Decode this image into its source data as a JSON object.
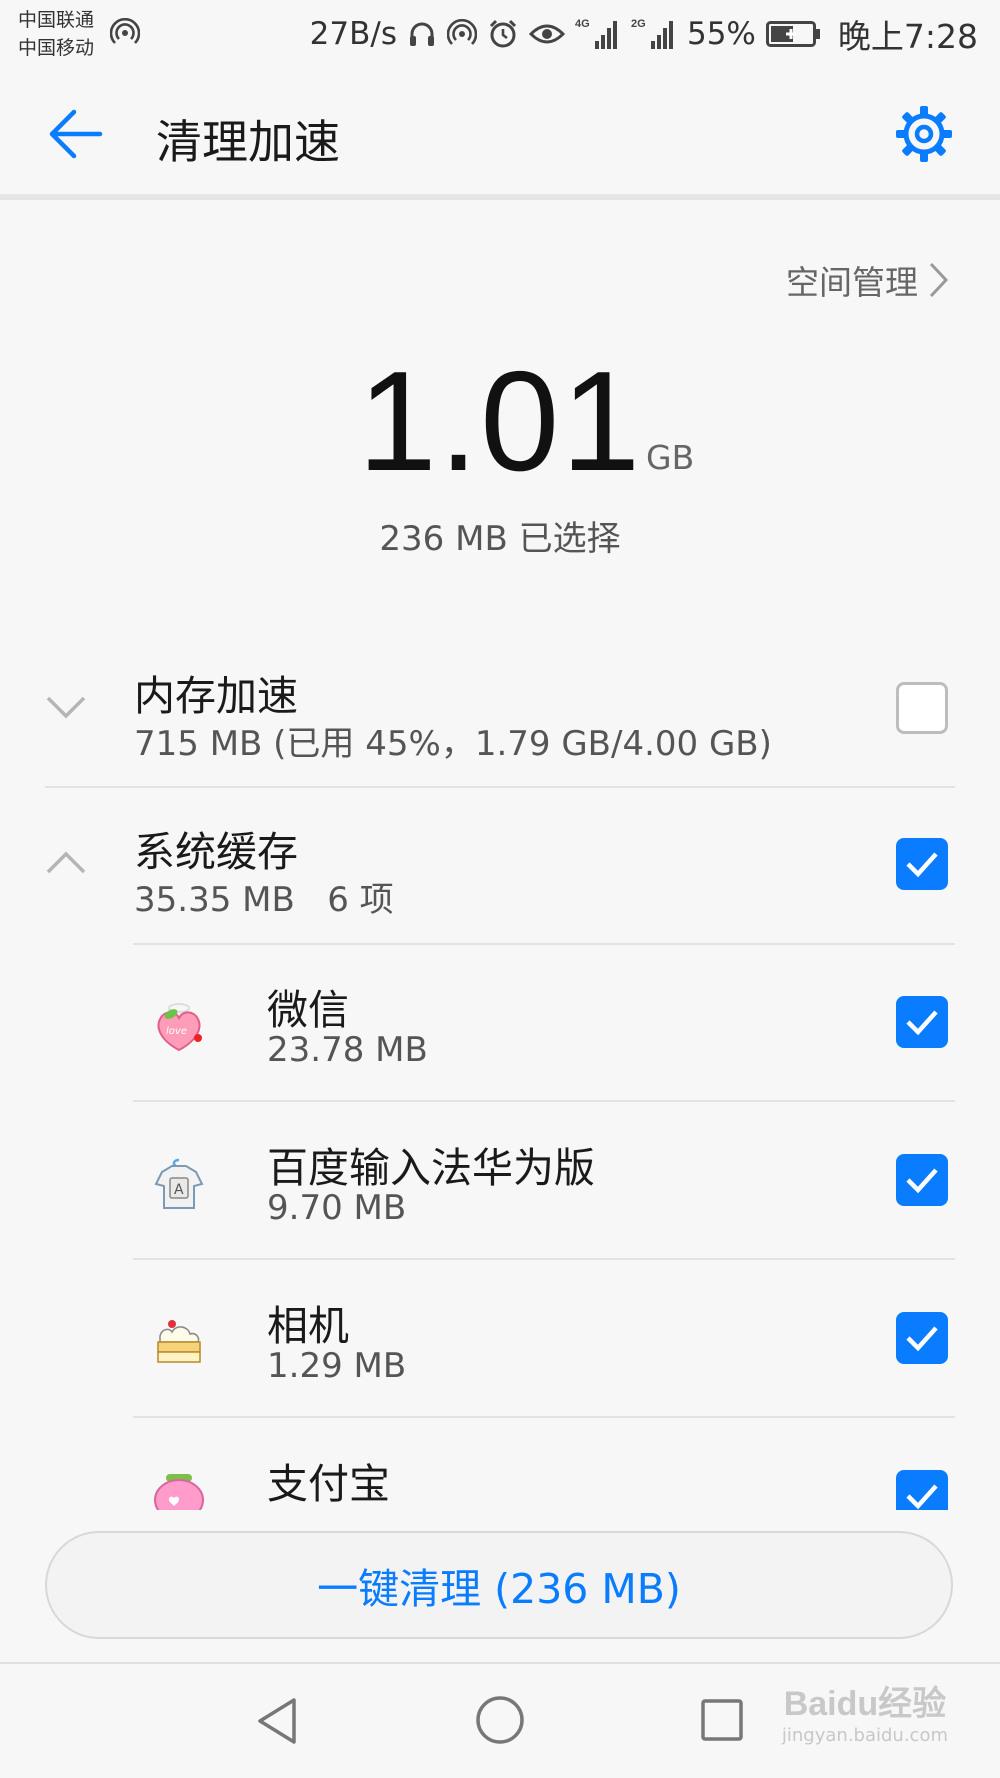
{
  "status_bar": {
    "carrier_1": "中国联通",
    "carrier_2": "中国移动",
    "net_speed": "27B/s",
    "signal_1_type": "4G",
    "signal_2_type": "2G",
    "battery_percent": "55%",
    "battery_level": 0.55,
    "clock": "晚上7:28",
    "icons": [
      "hotspot-icon",
      "headphone-icon",
      "hotspot-icon",
      "alarm-icon",
      "eye-icon",
      "signal-4g-icon",
      "signal-2g-icon",
      "battery-charging-icon"
    ]
  },
  "header": {
    "title": "清理加速",
    "back_icon": "arrow-left-icon",
    "settings_icon": "gear-icon"
  },
  "space_management": {
    "label": "空间管理"
  },
  "summary": {
    "total_value": "1.01",
    "total_unit": "GB",
    "selected_text": "236 MB 已选择"
  },
  "sections": [
    {
      "title": "内存加速",
      "subtitle": "715 MB (已用 45%，1.79 GB/4.00 GB)",
      "expanded": false,
      "checked": false
    },
    {
      "title": "系统缓存",
      "subtitle": "35.35 MB   6 项",
      "expanded": true,
      "checked": true
    }
  ],
  "apps": [
    {
      "name": "微信",
      "size": "23.78 MB",
      "checked": true,
      "icon": "peach-love-icon"
    },
    {
      "name": "百度输入法华为版",
      "size": "9.70 MB",
      "checked": true,
      "icon": "shirt-keyboard-icon"
    },
    {
      "name": "相机",
      "size": "1.29 MB",
      "checked": true,
      "icon": "cake-icon"
    },
    {
      "name": "支付宝",
      "size": "",
      "checked": true,
      "icon": "pink-purse-icon"
    }
  ],
  "clean_button": {
    "label": "一键清理 (236 MB)"
  },
  "watermark": {
    "logo": "Baidu经验",
    "url": "jingyan.baidu.com"
  },
  "colors": {
    "accent": "#0a7cff",
    "background": "#f7f7f7",
    "checkbox_off": "#bdbdbd"
  }
}
